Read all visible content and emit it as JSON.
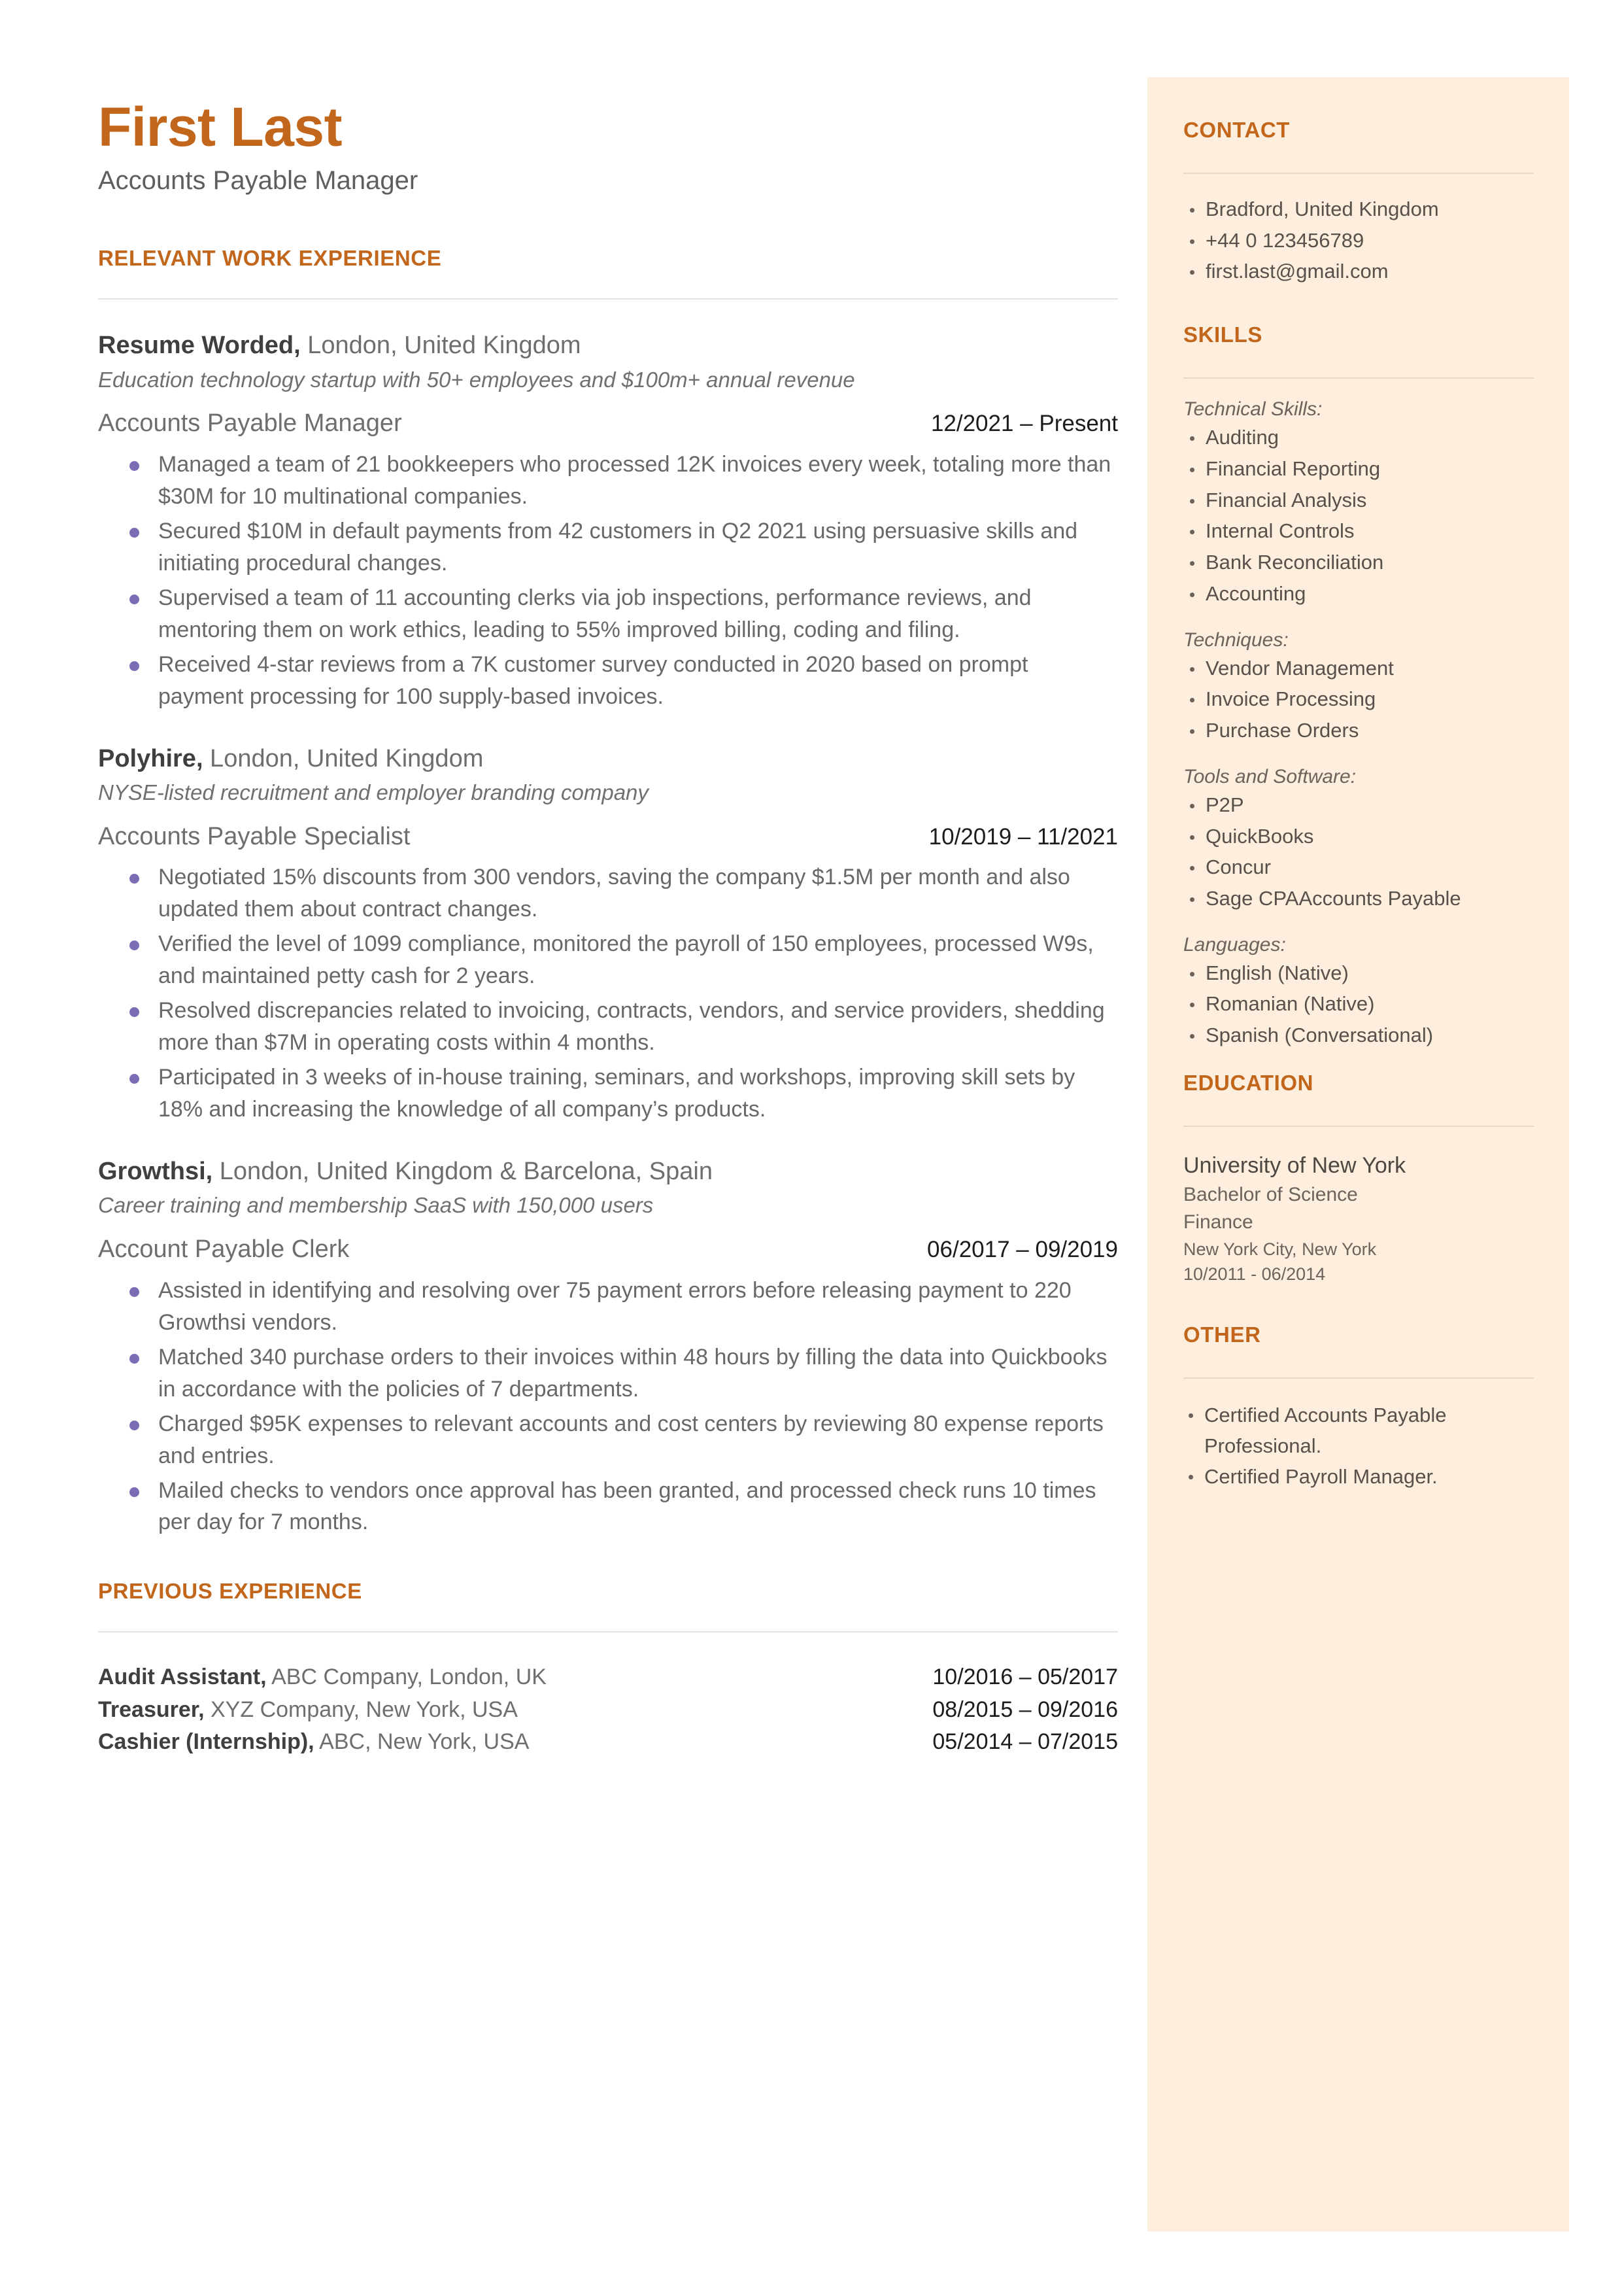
{
  "header": {
    "name": "First Last",
    "headline": "Accounts Payable Manager"
  },
  "colors": {
    "accent": "#c2661b",
    "sidebar_bg": "#fdeedd",
    "bullet": "#7b6cb5",
    "body_text": "#686868"
  },
  "sections": {
    "relevant_work_experience": "RELEVANT WORK EXPERIENCE",
    "previous_experience": "PREVIOUS EXPERIENCE",
    "contact": "CONTACT",
    "skills": "SKILLS",
    "education": "EDUCATION",
    "other": "OTHER"
  },
  "experience": [
    {
      "company": "Resume Worded,",
      "location": " London, United Kingdom",
      "description": "Education technology startup with 50+ employees and $100m+ annual revenue",
      "role": "Accounts Payable Manager",
      "dates": "12/2021 – Present",
      "bullets": [
        "Managed a team of 21 bookkeepers who processed 12K invoices every week, totaling more than $30M for 10 multinational companies.",
        "Secured $10M in default payments from 42 customers in Q2 2021 using persuasive skills and initiating procedural changes.",
        "Supervised a team of 11 accounting clerks via job inspections, performance reviews, and mentoring them on work ethics, leading to 55% improved billing, coding and filing.",
        "Received 4-star reviews from a 7K customer survey conducted in 2020 based on prompt payment processing for 100 supply-based invoices."
      ]
    },
    {
      "company": "Polyhire,",
      "location": " London, United Kingdom",
      "description": "NYSE-listed recruitment and employer branding company",
      "role": "Accounts Payable Specialist",
      "dates": "10/2019 – 11/2021",
      "bullets": [
        "Negotiated 15% discounts from 300 vendors, saving the company $1.5M per month and also updated them about contract changes.",
        "Verified the level of 1099 compliance, monitored the payroll of 150 employees, processed W9s, and maintained petty cash for 2 years.",
        "Resolved discrepancies related to invoicing, contracts, vendors, and service providers, shedding more than $7M in operating costs within 4 months.",
        "Participated in 3 weeks of in-house training, seminars, and workshops, improving skill sets by 18% and increasing the knowledge of all company’s products."
      ]
    },
    {
      "company": "Growthsi,",
      "location": " London, United Kingdom & Barcelona, Spain",
      "description": "Career training and membership SaaS with 150,000 users",
      "role": "Account Payable Clerk",
      "dates": "06/2017 – 09/2019",
      "bullets": [
        "Assisted in identifying and resolving over 75 payment errors before releasing payment to 220 Growthsi vendors.",
        "Matched 340 purchase orders to their invoices within 48 hours by filling the data into Quickbooks in accordance with the policies of 7 departments.",
        "Charged $95K expenses to relevant accounts and cost centers by reviewing 80 expense reports and entries.",
        "Mailed checks to vendors once approval has been granted, and processed check runs 10 times per day for 7 months."
      ]
    }
  ],
  "previous_experience": [
    {
      "title": "Audit Assistant,",
      "detail": " ABC Company, London, UK",
      "dates": "10/2016 – 05/2017"
    },
    {
      "title": "Treasurer,",
      "detail": " XYZ Company, New York, USA",
      "dates": "08/2015 – 09/2016"
    },
    {
      "title": "Cashier (Internship),",
      "detail": " ABC, New York, USA",
      "dates": "05/2014 – 07/2015"
    }
  ],
  "contact": [
    "Bradford, United Kingdom",
    "+44 0 123456789",
    "first.last@gmail.com"
  ],
  "skills": [
    {
      "label": "Technical Skills:",
      "items": [
        "Auditing",
        "Financial Reporting",
        "Financial Analysis",
        "Internal Controls",
        "Bank Reconciliation",
        "Accounting"
      ]
    },
    {
      "label": "Techniques:",
      "items": [
        "Vendor Management",
        "Invoice Processing",
        "Purchase Orders"
      ]
    },
    {
      "label": "Tools and Software:",
      "items": [
        "P2P",
        "QuickBooks",
        "Concur",
        "Sage CPAAccounts Payable"
      ]
    },
    {
      "label": "Languages:",
      "items": [
        "English (Native)",
        "Romanian (Native)",
        "Spanish (Conversational)"
      ]
    }
  ],
  "education": {
    "school": "University of New York",
    "degree": "Bachelor of Science",
    "field": "Finance",
    "location": "New York City, New York",
    "dates": "10/2011 - 06/2014"
  },
  "other": [
    "Certified Accounts Payable Professional.",
    "Certified Payroll Manager."
  ]
}
